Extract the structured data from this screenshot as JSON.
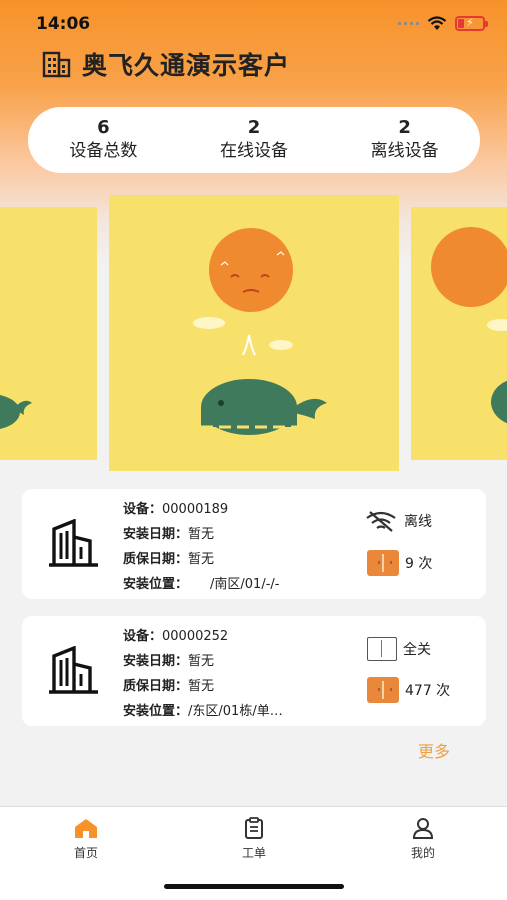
{
  "status_bar": {
    "time": "14:06"
  },
  "header": {
    "title": "奥飞久通演示客户"
  },
  "stats": [
    {
      "value": "6",
      "label": "设备总数"
    },
    {
      "value": "2",
      "label": "在线设备"
    },
    {
      "value": "2",
      "label": "离线设备"
    }
  ],
  "devices": [
    {
      "device_label": "设备：",
      "device_id": "00000189",
      "install_date_label": "安装日期：",
      "install_date": "暂无",
      "warranty_label": "质保日期：",
      "warranty": "暂无",
      "location_label": "安装位置：",
      "location": "/南区/01/-/-",
      "status": "离线",
      "count": "9 次"
    },
    {
      "device_label": "设备：",
      "device_id": "00000252",
      "install_date_label": "安装日期：",
      "install_date": "暂无",
      "warranty_label": "质保日期：",
      "warranty": "暂无",
      "location_label": "安装位置：",
      "location": "/东区/01栋/单…",
      "status": "全关",
      "count": "477 次"
    }
  ],
  "more_label": "更多",
  "tabs": [
    {
      "label": "首页",
      "icon": "home-icon"
    },
    {
      "label": "工单",
      "icon": "clipboard-icon"
    },
    {
      "label": "我的",
      "icon": "person-icon"
    }
  ],
  "colors": {
    "accent": "#f7922a",
    "banner": "#f8e16a",
    "badge": "#e9873a",
    "more": "#f0a040"
  }
}
